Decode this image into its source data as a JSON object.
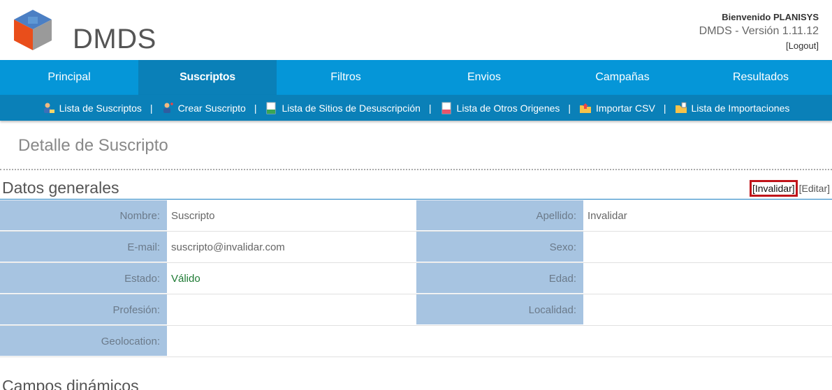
{
  "header": {
    "logo_text": "DMDS",
    "welcome": "Bienvenido PLANISYS",
    "version": "DMDS - Versión 1.11.12",
    "logout": "[Logout]"
  },
  "main_nav": [
    {
      "label": "Principal",
      "active": false
    },
    {
      "label": "Suscriptos",
      "active": true
    },
    {
      "label": "Filtros",
      "active": false
    },
    {
      "label": "Envios",
      "active": false
    },
    {
      "label": "Campañas",
      "active": false
    },
    {
      "label": "Resultados",
      "active": false
    }
  ],
  "sub_nav": [
    {
      "label": "Lista de Suscriptos",
      "icon": "users-list-icon"
    },
    {
      "label": "Crear Suscripto",
      "icon": "add-user-icon"
    },
    {
      "label": "Lista de Sitios de Desuscripción",
      "icon": "document-green-icon"
    },
    {
      "label": "Lista de Otros Origenes",
      "icon": "document-red-icon"
    },
    {
      "label": "Importar CSV",
      "icon": "folder-import-icon"
    },
    {
      "label": "Lista de Importaciones",
      "icon": "folder-list-icon"
    }
  ],
  "page_title": "Detalle de Suscripto",
  "section": {
    "title": "Datos generales",
    "invalidar": "[Invalidar]",
    "editar": "[Editar]"
  },
  "fields": {
    "nombre_label": "Nombre:",
    "nombre": "Suscripto",
    "apellido_label": "Apellido:",
    "apellido": "Invalidar",
    "email_label": "E-mail:",
    "email": "suscripto@invalidar.com",
    "sexo_label": "Sexo:",
    "sexo": "",
    "estado_label": "Estado:",
    "estado": "Válido",
    "edad_label": "Edad:",
    "edad": "",
    "profesion_label": "Profesión:",
    "profesion": "",
    "localidad_label": "Localidad:",
    "localidad": "",
    "geolocation_label": "Geolocation:",
    "geolocation": ""
  },
  "section2_title": "Campos dinámicos",
  "colors": {
    "nav_blue": "#0596d8",
    "nav_dark": "#0a80b8",
    "label_bg": "#a7c4e1",
    "valid_green": "#1e7b34",
    "highlight_red": "#c0141a"
  }
}
